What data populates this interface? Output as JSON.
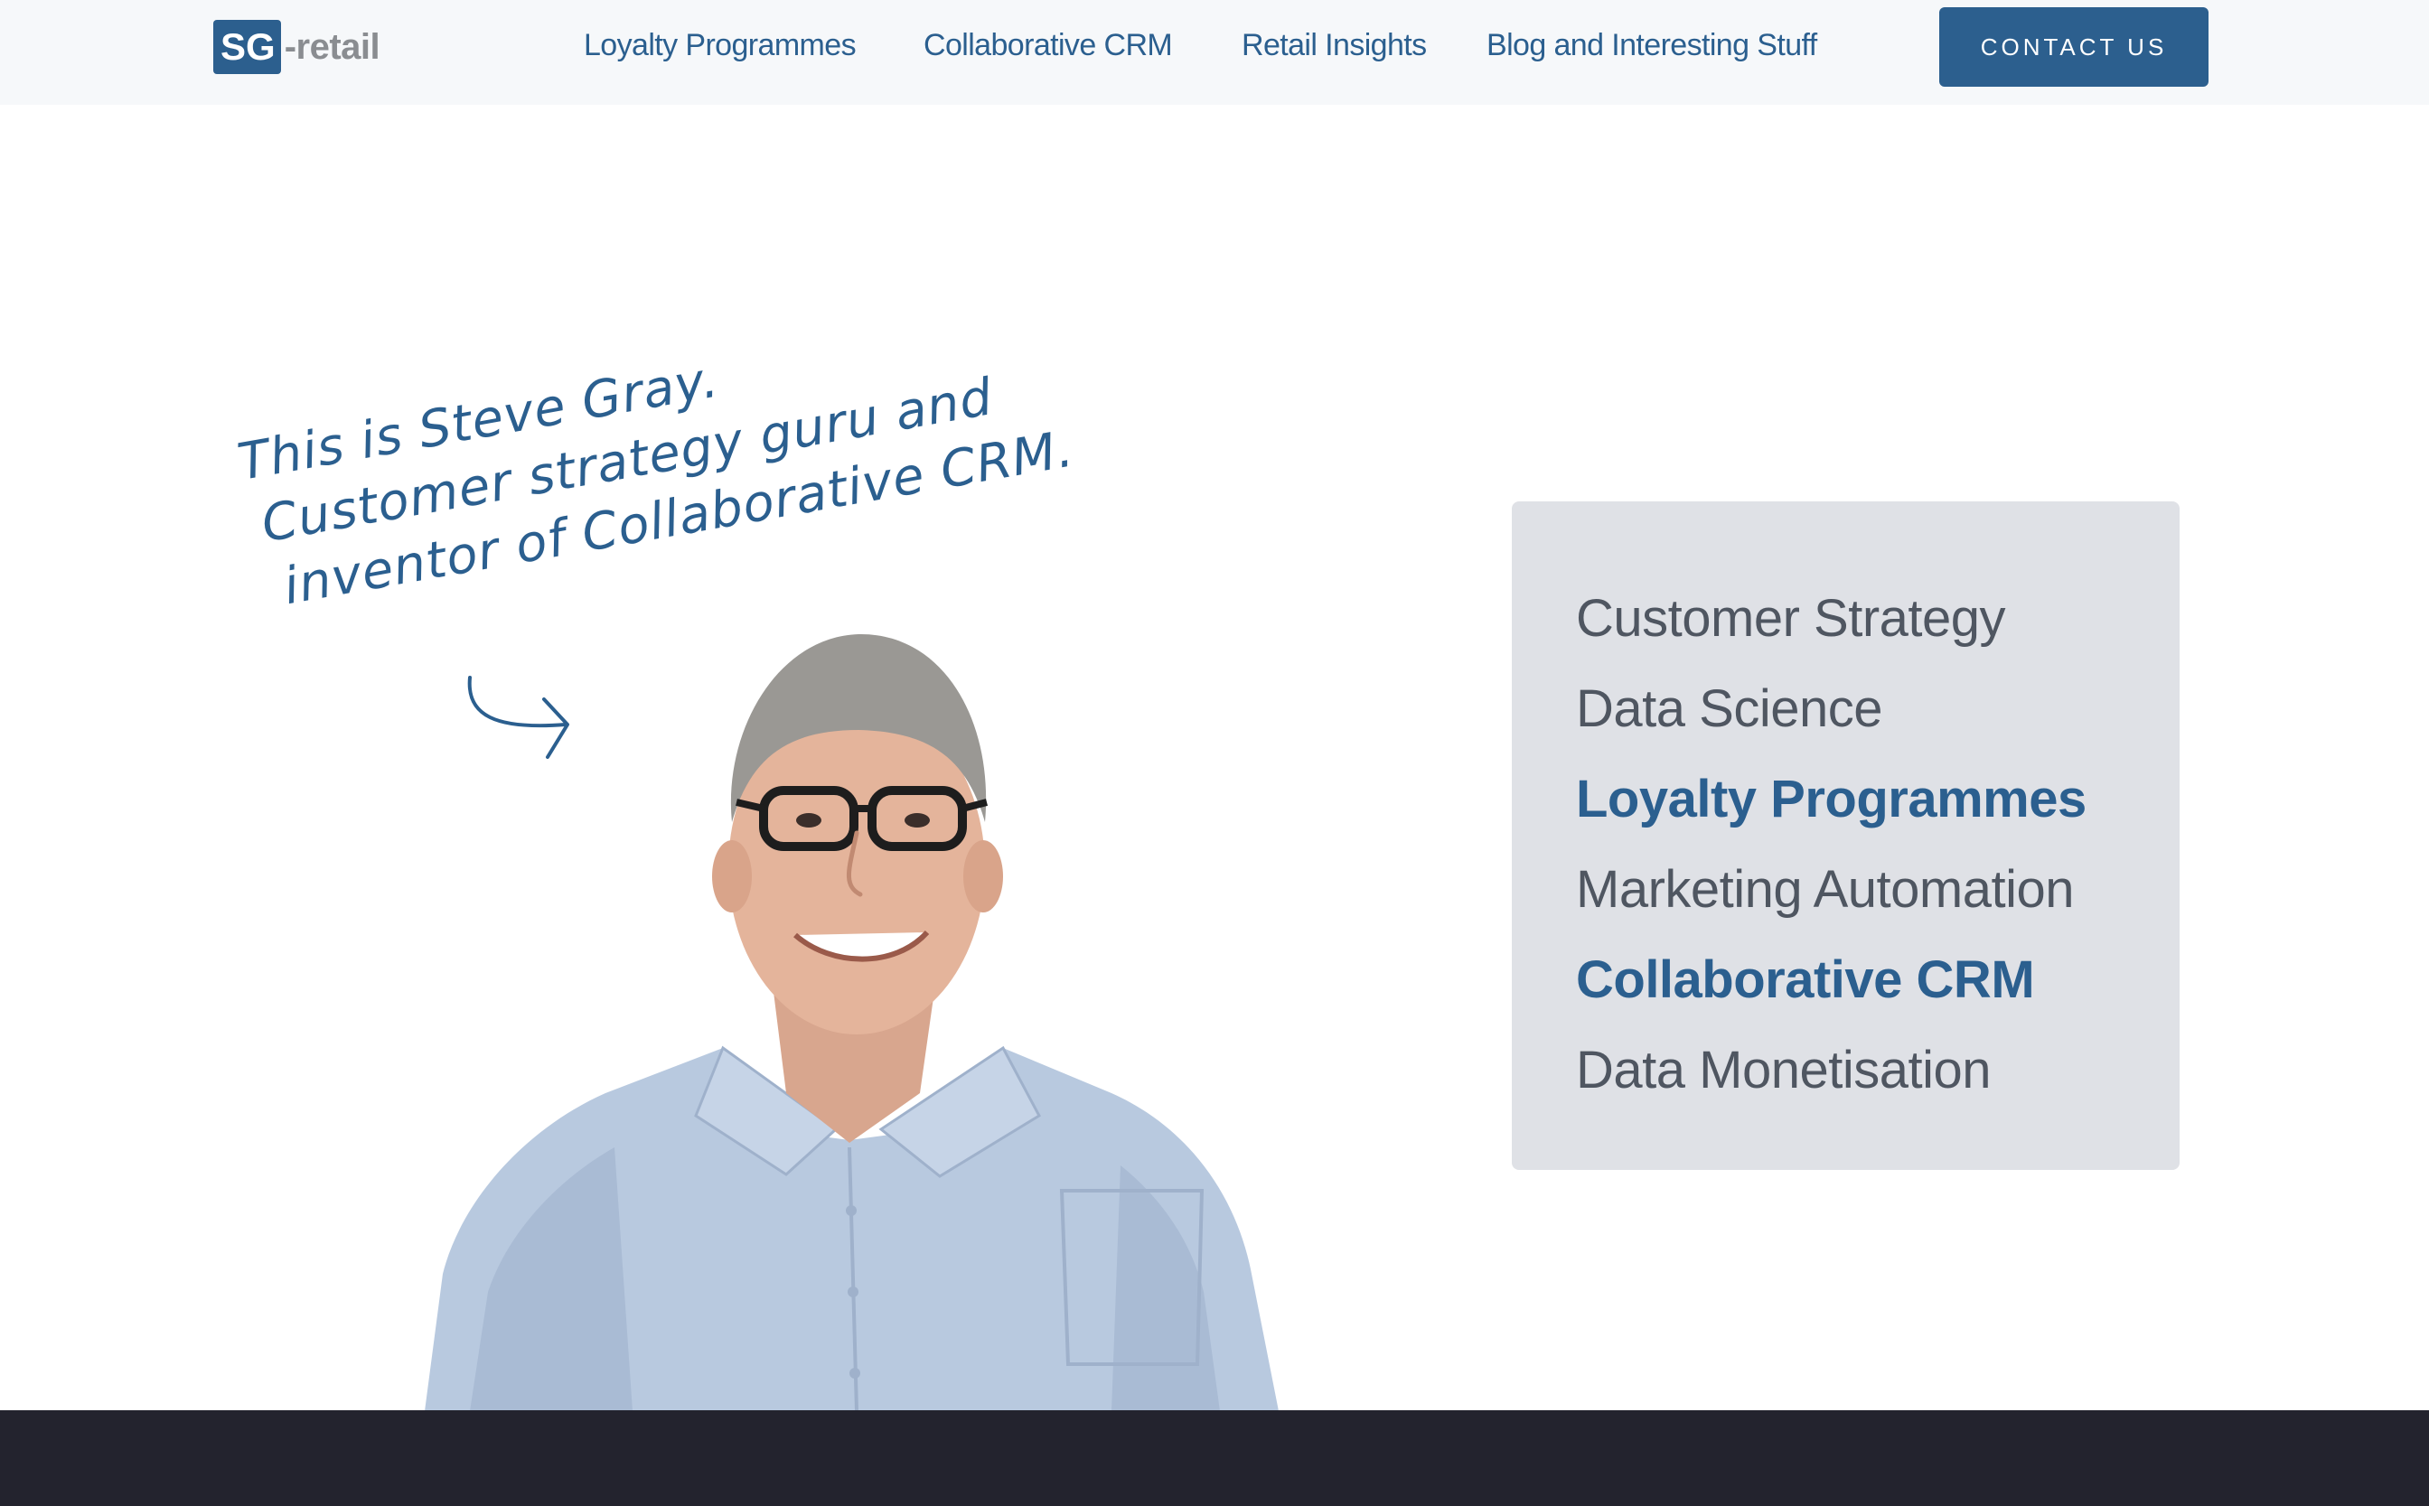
{
  "header": {
    "logo": {
      "box_text": "SG",
      "rest_text": "-retail"
    },
    "nav": [
      {
        "label": "Loyalty Programmes"
      },
      {
        "label": "Collaborative CRM"
      },
      {
        "label": "Retail Insights"
      },
      {
        "label": "Blog and Interesting Stuff"
      }
    ],
    "cta_label": "CONTACT US"
  },
  "hero": {
    "note_lines": [
      "This is Steve Gray.",
      "Customer strategy guru and",
      "inventor of Collaborative CRM."
    ],
    "arrow_icon": "curved-arrow-right-icon"
  },
  "services": [
    {
      "label": "Customer Strategy",
      "highlighted": false
    },
    {
      "label": "Data Science",
      "highlighted": false
    },
    {
      "label": "Loyalty Programmes",
      "highlighted": true
    },
    {
      "label": "Marketing Automation",
      "highlighted": false
    },
    {
      "label": "Collaborative CRM",
      "highlighted": true
    },
    {
      "label": "Data Monetisation",
      "highlighted": false
    }
  ],
  "colors": {
    "brand_blue": "#2c5f8e",
    "header_bg": "#f6f8fa",
    "card_bg": "#dfe1e6",
    "muted_text": "#4f5661",
    "footer_bg": "#23232e"
  }
}
